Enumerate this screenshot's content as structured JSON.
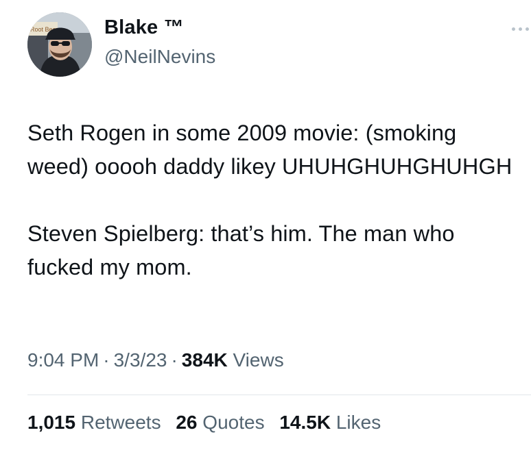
{
  "author": {
    "display_name": "Blake ™",
    "handle": "@NeilNevins",
    "avatar_sign_text": "Root Bee"
  },
  "more_icon": "more-horizontal-icon",
  "tweet": {
    "text": "Seth Rogen in some 2009 movie: (smoking weed) ooooh daddy likey UHUHGHUHGHUHGH\n\nSteven Spielberg: that’s him. The man who fucked my mom."
  },
  "meta": {
    "time": "9:04 PM",
    "separator": "·",
    "date": "3/3/23",
    "views_count": "384K",
    "views_label": "Views"
  },
  "stats": [
    {
      "count": "1,015",
      "label": "Retweets"
    },
    {
      "count": "26",
      "label": "Quotes"
    },
    {
      "count": "14.5K",
      "label": "Likes"
    }
  ]
}
